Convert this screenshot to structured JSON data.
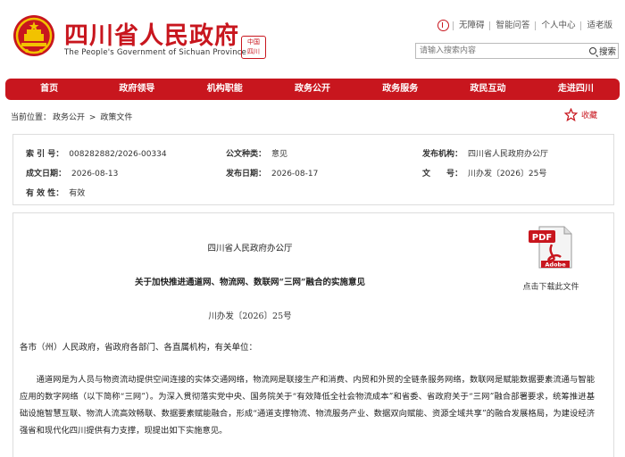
{
  "header": {
    "title": "四川省人民政府",
    "subtitle": "The People's Government of Sichuan Province",
    "links": [
      "无障碍",
      "智能问答",
      "个人中心",
      "适老版"
    ],
    "search_placeholder": "请输入搜索内容",
    "search_button": "搜索"
  },
  "nav": {
    "items": [
      "首页",
      "政府领导",
      "机构职能",
      "政务公开",
      "政务服务",
      "政民互动",
      "走进四川"
    ]
  },
  "breadcrumb": {
    "prefix": "当前位置：",
    "items": [
      "政务公开",
      "政策文件"
    ],
    "separator": ">",
    "favorite": "收藏"
  },
  "info": {
    "index_label": "索 引 号：",
    "index_value": "008282882/2026-00334",
    "category_label": "公文种类：",
    "category_value": "意见",
    "agency_label": "发布机构：",
    "agency_value": "四川省人民政府办公厅",
    "created_label": "成文日期：",
    "created_value": "2026-08-13",
    "published_label": "发布日期：",
    "published_value": "2026-08-17",
    "docno_label": "文　　号：",
    "docno_value": "川办发〔2026〕25号",
    "validity_label": "有 效 性：",
    "validity_value": "有效"
  },
  "document": {
    "issuer": "四川省人民政府办公厅",
    "title": "关于加快推进通道网、物流网、数联网“三网”融合的实施意见",
    "number": "川办发〔2026〕25号",
    "salutation": "各市（州）人民政府，省政府各部门、各直属机构，有关单位：",
    "paragraph": "通道网是为人员与物资流动提供空间连接的实体交通网络，物流网是联接生产和消费、内贸和外贸的全链条服务网络，数联网是赋能数据要素流通与智能应用的数字网络（以下简称“三网”）。为深入贯彻落实党中央、国务院关于“有效降低全社会物流成本”和省委、省政府关于“三网”融合部署要求，统筹推进基础设施智慧互联、物流人流高效畅联、数据要素赋能融合，形成“通道支撑物流、物流服务产业、数据双向赋能、资源全域共享”的融合发展格局，为建设经济强省和现代化四川提供有力支撑，现提出如下实施意见。"
  },
  "download": {
    "label": "点击下载此文件",
    "pdf_badge": "PDF",
    "brand": "Adobe"
  },
  "colors": {
    "brand_red": "#c8161e"
  }
}
